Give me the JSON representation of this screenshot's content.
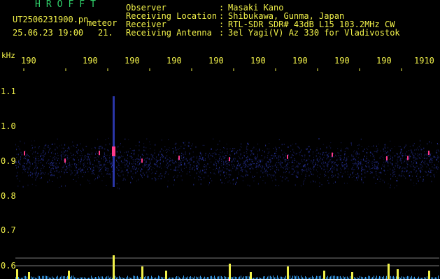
{
  "header": {
    "brand": "HROFFT",
    "filename": "UT2506231900.pn",
    "mode": "meteor",
    "timestamp": "25.06.23 19:00",
    "count": "21.",
    "info": [
      {
        "label": "Observer",
        "value": "Masaki Kano"
      },
      {
        "label": "Receiving Location",
        "value": "Shibukawa, Gunma, Japan"
      },
      {
        "label": "Receiver",
        "value": "RTL-SDR SDR# 43dB L15 103.2MHz CW"
      },
      {
        "label": "Receiving Antenna",
        "value": "3el Yagi(V) Az 330 for Vladivostok"
      }
    ]
  },
  "axes": {
    "y_unit": "kHz",
    "y_ticks": [
      "1.1",
      "1.0",
      "0.9",
      "0.8",
      "0.7",
      "0.6"
    ],
    "x_ticks": [
      "190",
      "190",
      "190",
      "190",
      "190",
      "190",
      "190",
      "190",
      "190",
      "1910"
    ]
  },
  "colors": {
    "text": "#f2f24a",
    "brand": "#2fd16a",
    "background": "#000000",
    "noise": "#2a36a8",
    "echo_hot": "#ff3a8a",
    "meter_peak": "#f2f24a",
    "meter_base": "#3aa8ff"
  }
}
